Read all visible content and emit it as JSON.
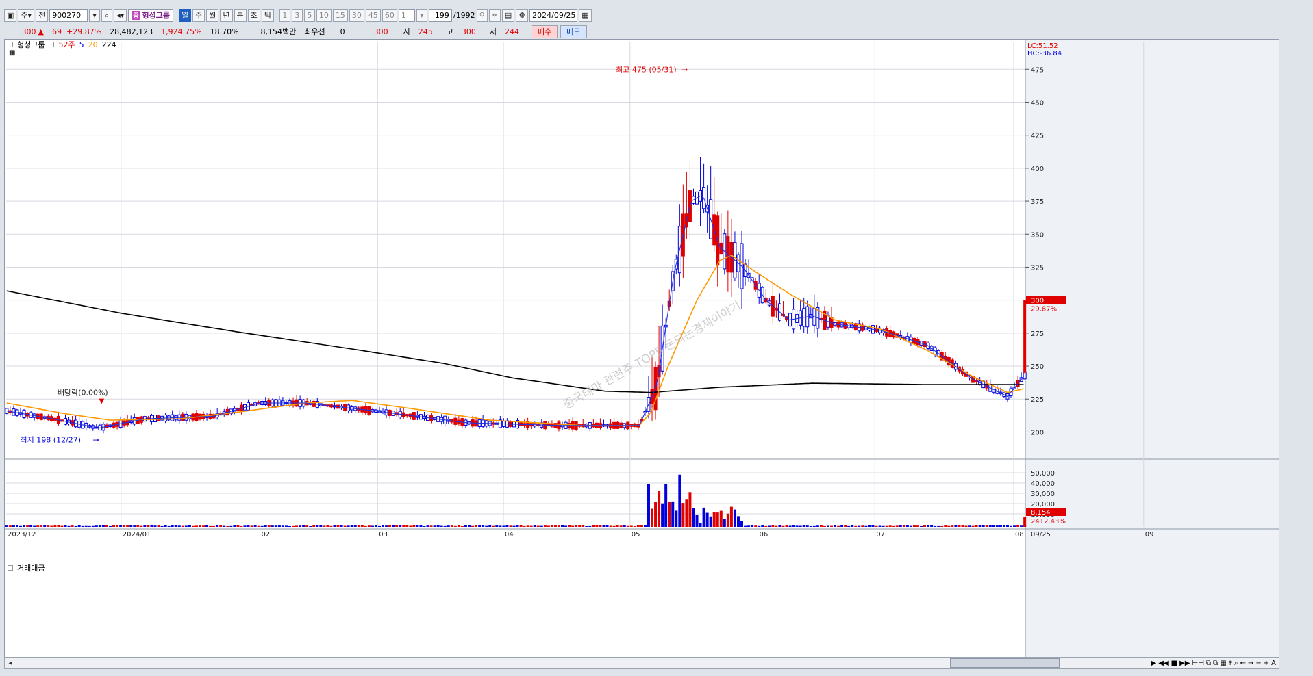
{
  "toolbar": {
    "market_label": "주",
    "prev_label": "전",
    "code": "900270",
    "stock_badge": "종",
    "stock_name": "헝셩그룹",
    "periods": [
      "일",
      "주",
      "월",
      "년",
      "분",
      "초",
      "틱"
    ],
    "active_period": "일",
    "intervals": [
      "1",
      "3",
      "5",
      "10",
      "15",
      "30",
      "45",
      "60"
    ],
    "count_value": "1",
    "position": "199",
    "total": "/1992",
    "date": "2024/09/25"
  },
  "quote": {
    "price": "300",
    "change": "69",
    "change_pct": "+29.87%",
    "volume": "28,482,123",
    "volume_ratio": "1,924.75%",
    "turnover": "18.70%",
    "amount": "8,154백만",
    "best_label": "최우선",
    "best_value": "0",
    "best_price": "300",
    "open_label": "시",
    "open": "245",
    "high_label": "고",
    "high": "300",
    "low_label": "저",
    "low": "244",
    "buy_label": "매수",
    "sell_label": "매도"
  },
  "legend": {
    "name": "헝셩그룹",
    "ma52": "52주",
    "ma5": "5",
    "ma20": "20",
    "ma224": "224"
  },
  "annotations": {
    "high": "최고 475 (05/31)",
    "low": "최저 198 (12/27)",
    "dividend": "배당락(0.00%)",
    "watermark": "중국테마 관련주 TOP5 돈되는경제이야기",
    "lc": "LC:51.52",
    "hc": "HC:-36.84",
    "last_price": "300",
    "last_pct": "29.87%",
    "vol_last": "8,154",
    "vol_pct": "2412.43%"
  },
  "volume_panel": {
    "title": "거래대금",
    "ticks": [
      "50,000",
      "40,000",
      "30,000",
      "20,000",
      "10,000"
    ]
  },
  "colors": {
    "up": "#e10000",
    "down": "#0000dd",
    "ma5": "#2233dd",
    "ma20": "#ff9900",
    "ma224": "#000000",
    "grid": "#d5d9e0"
  },
  "chart_data": {
    "type": "candlestick",
    "price_axis": [
      200,
      225,
      250,
      275,
      300,
      325,
      350,
      375,
      400,
      425,
      450,
      475
    ],
    "ylim": [
      180,
      485
    ],
    "x_labels": [
      "2023/12",
      "2024/01",
      "02",
      "03",
      "04",
      "05",
      "06",
      "07",
      "08",
      "09",
      "09/25"
    ],
    "summary": {
      "period_high": 475,
      "period_high_date": "05/31",
      "period_low": 198,
      "period_low_date": "12/27",
      "last_close": 300,
      "last_open": 245,
      "last_high": 300,
      "last_low": 244
    },
    "ma224": [
      [
        0,
        307
      ],
      [
        100,
        290
      ],
      [
        200,
        276
      ],
      [
        300,
        263
      ],
      [
        380,
        252
      ],
      [
        440,
        241
      ],
      [
        520,
        231
      ],
      [
        560,
        230
      ],
      [
        620,
        234
      ],
      [
        700,
        237
      ],
      [
        800,
        236
      ],
      [
        885,
        236
      ]
    ],
    "ma20": [
      [
        0,
        222
      ],
      [
        50,
        214
      ],
      [
        90,
        209
      ],
      [
        150,
        210
      ],
      [
        200,
        215
      ],
      [
        260,
        222
      ],
      [
        300,
        224
      ],
      [
        350,
        218
      ],
      [
        420,
        209
      ],
      [
        500,
        205
      ],
      [
        550,
        205
      ],
      [
        560,
        215
      ],
      [
        575,
        250
      ],
      [
        600,
        300
      ],
      [
        620,
        330
      ],
      [
        630,
        334
      ],
      [
        650,
        322
      ],
      [
        680,
        305
      ],
      [
        720,
        285
      ],
      [
        760,
        278
      ],
      [
        800,
        262
      ],
      [
        840,
        242
      ],
      [
        870,
        230
      ],
      [
        885,
        233
      ]
    ],
    "ma5": [
      [
        0,
        216
      ],
      [
        40,
        210
      ],
      [
        80,
        203
      ],
      [
        120,
        210
      ],
      [
        180,
        212
      ],
      [
        220,
        222
      ],
      [
        260,
        222
      ],
      [
        320,
        216
      ],
      [
        400,
        207
      ],
      [
        480,
        205
      ],
      [
        550,
        205
      ],
      [
        565,
        235
      ],
      [
        580,
        320
      ],
      [
        595,
        375
      ],
      [
        605,
        380
      ],
      [
        620,
        340
      ],
      [
        640,
        325
      ],
      [
        660,
        300
      ],
      [
        680,
        285
      ],
      [
        700,
        288
      ],
      [
        720,
        282
      ],
      [
        760,
        277
      ],
      [
        800,
        266
      ],
      [
        840,
        240
      ],
      [
        870,
        227
      ],
      [
        885,
        243
      ]
    ]
  }
}
